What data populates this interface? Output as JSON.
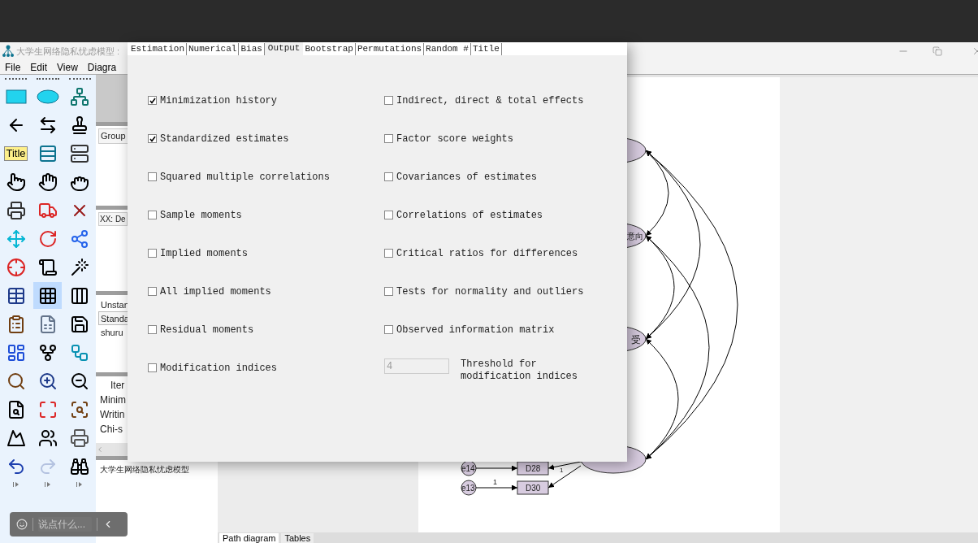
{
  "window": {
    "title": "大学生网络隐私忧虑模型 :"
  },
  "menu": [
    "File",
    "Edit",
    "View",
    "Diagra"
  ],
  "toolbar": {
    "tools": [
      {
        "selected": false
      },
      {
        "selected": false
      },
      {
        "selected": false
      },
      {
        "selected": false
      },
      {
        "selected": false
      },
      {
        "selected": false
      },
      {
        "selected": false,
        "label": "Title"
      },
      {
        "selected": false
      },
      {
        "selected": false
      },
      {
        "selected": false
      },
      {
        "selected": false
      },
      {
        "selected": false
      },
      {
        "selected": false
      },
      {
        "selected": false
      },
      {
        "selected": false
      },
      {
        "selected": false
      },
      {
        "selected": false
      },
      {
        "selected": false
      },
      {
        "selected": false
      },
      {
        "selected": false
      },
      {
        "selected": false
      },
      {
        "selected": false
      },
      {
        "selected": true
      },
      {
        "selected": false
      },
      {
        "selected": false
      },
      {
        "selected": false
      },
      {
        "selected": false
      },
      {
        "selected": false
      },
      {
        "selected": false
      },
      {
        "selected": false
      },
      {
        "selected": false
      },
      {
        "selected": false
      },
      {
        "selected": false
      },
      {
        "selected": false
      },
      {
        "selected": false
      },
      {
        "selected": false
      },
      {
        "selected": false
      },
      {
        "selected": false
      },
      {
        "selected": false
      },
      {
        "selected": false,
        "disabled": false
      },
      {
        "selected": false,
        "disabled": true
      },
      {
        "selected": false
      }
    ]
  },
  "panel": {
    "groups_header": "Group",
    "models_header": "XX: De",
    "estimates": [
      {
        "label": "Unstan",
        "selected": false
      },
      {
        "label": "Standa",
        "selected": true
      },
      {
        "label": "shuru",
        "selected": false
      }
    ],
    "messages": [
      "Iter",
      "Minim",
      "Writin",
      "Chi-s"
    ],
    "file_name": "大学生网络隐私忧虑模型"
  },
  "dialog": {
    "tabs": [
      {
        "label": "Estimation",
        "selected": false
      },
      {
        "label": "Numerical",
        "selected": false
      },
      {
        "label": "Bias",
        "selected": false
      },
      {
        "label": "Output",
        "selected": true
      },
      {
        "label": "Bootstrap",
        "selected": false
      },
      {
        "label": "Permutations",
        "selected": false
      },
      {
        "label": "Random #",
        "selected": false
      },
      {
        "label": "Title",
        "selected": false
      }
    ],
    "left_options": [
      {
        "label": "Minimization history",
        "checked": true
      },
      {
        "label": "Standardized estimates",
        "checked": true
      },
      {
        "label": "Squared multiple correlations",
        "checked": false
      },
      {
        "label": "Sample moments",
        "checked": false
      },
      {
        "label": "Implied moments",
        "checked": false
      },
      {
        "label": "All implied moments",
        "checked": false
      },
      {
        "label": "Residual moments",
        "checked": false
      },
      {
        "label": "Modification indices",
        "checked": false
      }
    ],
    "right_options": [
      {
        "label": "Indirect, direct & total effects",
        "checked": false
      },
      {
        "label": "Factor score weights",
        "checked": false
      },
      {
        "label": "Covariances of estimates",
        "checked": false
      },
      {
        "label": "Correlations of estimates",
        "checked": false
      },
      {
        "label": "Critical ratios for differences",
        "checked": false
      },
      {
        "label": "Tests for normality and outliers",
        "checked": false
      },
      {
        "label": "Observed information matrix",
        "checked": false
      }
    ],
    "threshold": {
      "value": "4",
      "label": "Threshold for modification indices",
      "disabled": true
    }
  },
  "diagram": {
    "latent_labels": [
      "意向",
      "受"
    ],
    "observed": [
      {
        "name": "D28",
        "error": "e14"
      },
      {
        "name": "D30",
        "error": "e13",
        "weight": "1"
      }
    ],
    "loading": "1"
  },
  "bottom_tabs": [
    {
      "label": "Path diagram",
      "selected": true
    },
    {
      "label": "Tables",
      "selected": false
    }
  ],
  "chat": {
    "placeholder": "说点什么..."
  }
}
